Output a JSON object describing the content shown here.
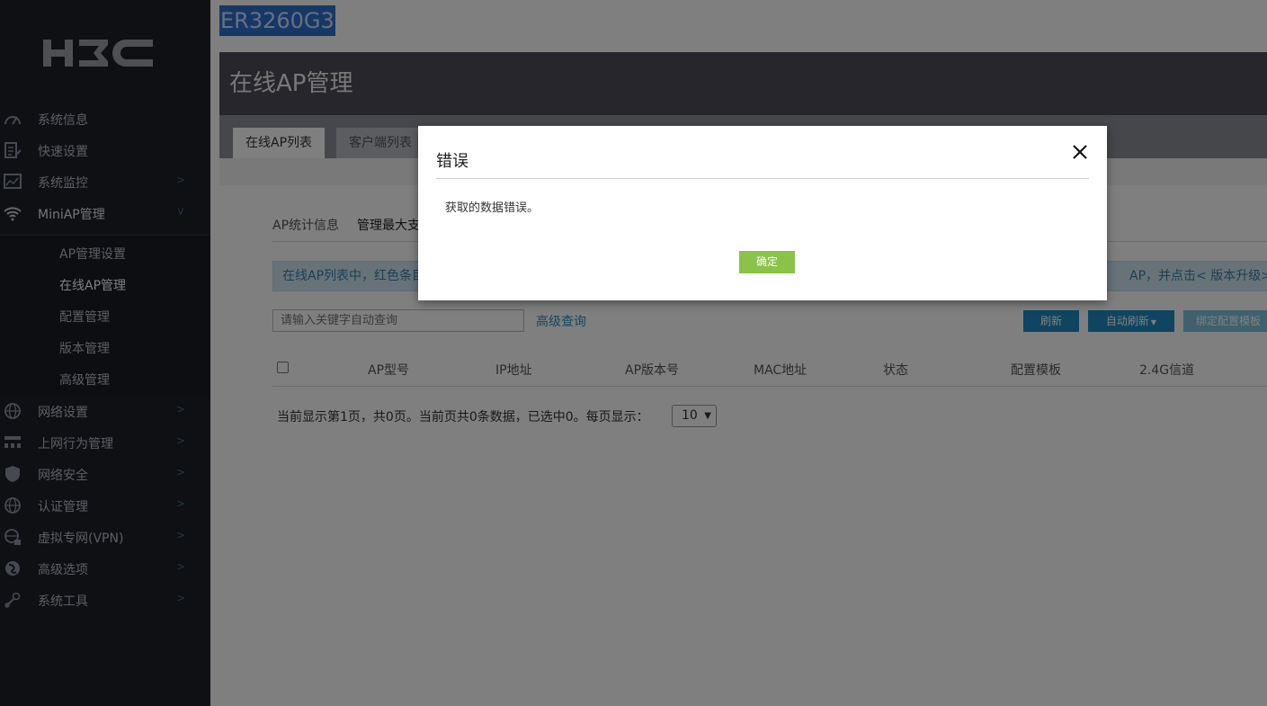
{
  "sidebar": {
    "logo_text": "H3C",
    "items": [
      {
        "label": "系统信息",
        "icon": "speedometer-icon",
        "has_children": false
      },
      {
        "label": "快速设置",
        "icon": "edit-document-icon",
        "has_children": false
      },
      {
        "label": "系统监控",
        "icon": "monitor-chart-icon",
        "has_children": true
      },
      {
        "label": "MiniAP管理",
        "icon": "wifi-icon",
        "has_children": true,
        "expanded": true
      },
      {
        "label": "网络设置",
        "icon": "globe-icon",
        "has_children": true
      },
      {
        "label": "上网行为管理",
        "icon": "network-tree-icon",
        "has_children": true
      },
      {
        "label": "网络安全",
        "icon": "shield-icon",
        "has_children": true
      },
      {
        "label": "认证管理",
        "icon": "globe-icon",
        "has_children": true
      },
      {
        "label": "虚拟专网(VPN)",
        "icon": "globe-lock-icon",
        "has_children": true
      },
      {
        "label": "高级选项",
        "icon": "settings-globe-icon",
        "has_children": true
      },
      {
        "label": "系统工具",
        "icon": "tools-icon",
        "has_children": true
      }
    ],
    "subitems": [
      "AP管理设置",
      "在线AP管理",
      "配置管理",
      "版本管理",
      "高级管理"
    ],
    "selected_subitem": "在线AP管理"
  },
  "header": {
    "device_name": "ER3260G3",
    "page_title": "在线AP管理",
    "tabs": [
      "在线AP列表",
      "客户端列表"
    ]
  },
  "content": {
    "stats_label": "AP统计信息",
    "stats_value": "管理最大支",
    "notice_left": "在线AP列表中，红色条目",
    "notice_right": "AP，并点击< 版本升级>按钮",
    "search_placeholder": "请输入关键字自动查询",
    "advanced_search": "高级查询",
    "buttons": {
      "refresh": "刷新",
      "auto_refresh": "自动刷新",
      "bind_template": "绑定配置模板"
    },
    "table_headers": [
      "AP型号",
      "IP地址",
      "AP版本号",
      "MAC地址",
      "状态",
      "配置模板",
      "2.4G信道"
    ],
    "pager_text": "当前显示第1页，共0页。当前页共0条数据，已选中0。每页显示：",
    "page_size": "10"
  },
  "modal": {
    "title": "错误",
    "message": "获取的数据错误。",
    "ok_label": "确定"
  },
  "colors": {
    "sidebar_bg": "#1f2129",
    "header_bg": "#4c4d59",
    "device_highlight": "#2f6fce",
    "primary_button": "#1f8bc0",
    "ok_button": "#8ac24a",
    "link": "#2a8fc2"
  }
}
